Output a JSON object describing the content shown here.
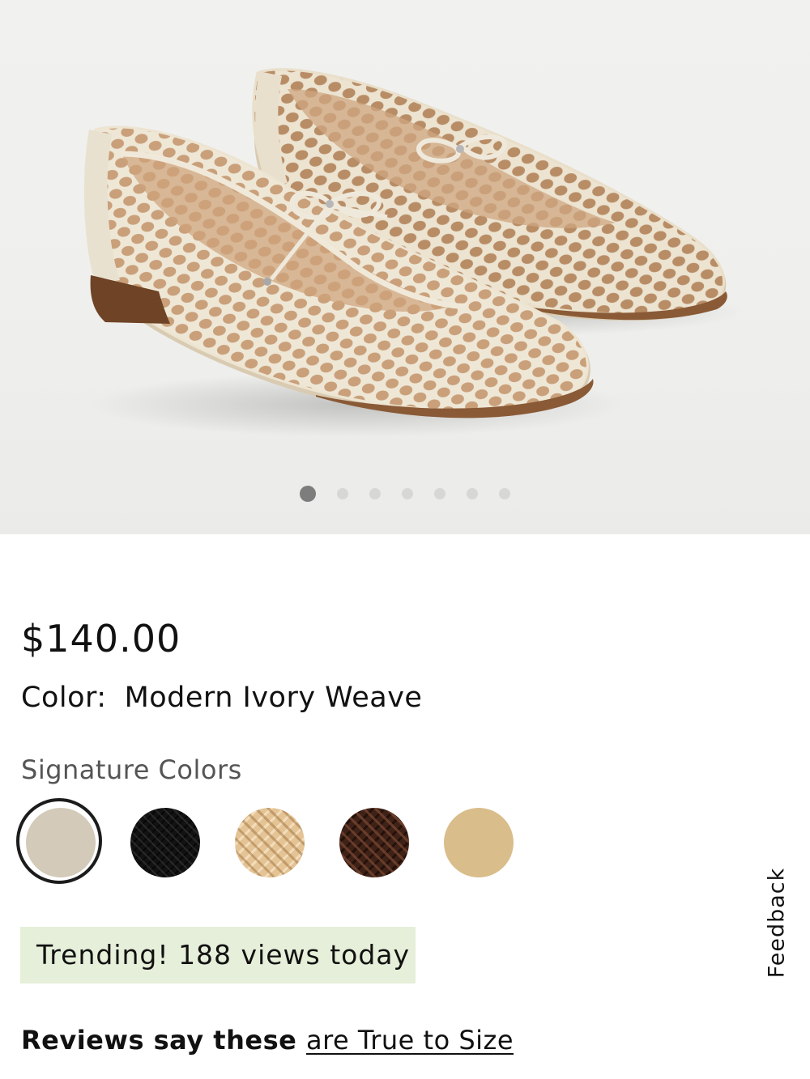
{
  "gallery": {
    "image_alt": "Modern Ivory Weave woven ballet flats",
    "slide_count": 7,
    "active_slide": 1
  },
  "product": {
    "price": "$140.00",
    "color_label": "Color:",
    "color_value": "Modern Ivory Weave"
  },
  "signature_colors": {
    "heading": "Signature Colors",
    "swatches": [
      {
        "color": "#d3cab9",
        "selected": true
      },
      {
        "color": "#161616",
        "selected": false
      },
      {
        "color": "#e2bf8f",
        "selected": false
      },
      {
        "color": "#4a2a1d",
        "selected": false
      },
      {
        "color": "#d9bd8a",
        "selected": false
      }
    ]
  },
  "trending": {
    "text": "Trending! 188 views today",
    "background": "#e6efd9"
  },
  "reviews": {
    "prefix": "Reviews say these",
    "link": "are True to Size"
  },
  "feedback": {
    "label": "Feedback"
  }
}
